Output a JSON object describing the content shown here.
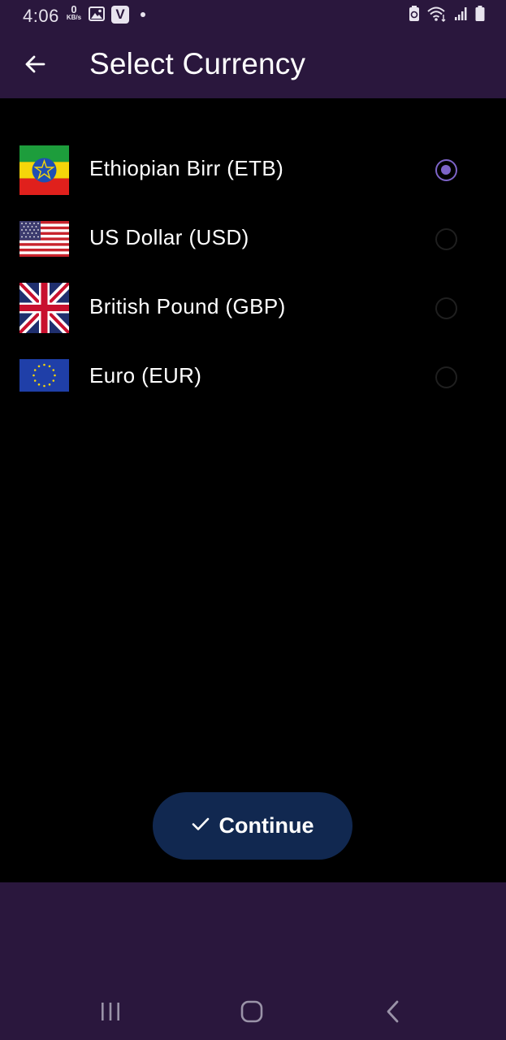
{
  "status_bar": {
    "time": "4:06",
    "net_speed_value": "0",
    "net_speed_unit": "KB/s",
    "app_icon_letter": "V"
  },
  "header": {
    "title": "Select Currency"
  },
  "currencies": [
    {
      "label": "Ethiopian Birr (ETB)",
      "flag_icon": "ethiopia-flag-icon",
      "selected": true
    },
    {
      "label": "US Dollar (USD)",
      "flag_icon": "usa-flag-icon",
      "selected": false
    },
    {
      "label": "British Pound (GBP)",
      "flag_icon": "uk-flag-icon",
      "selected": false
    },
    {
      "label": "Euro (EUR)",
      "flag_icon": "eu-flag-icon",
      "selected": false
    }
  ],
  "continue_button": {
    "label": "Continue",
    "icon": "check-icon"
  },
  "nav_bar": {
    "recents_icon": "recents-icon",
    "home_icon": "home-icon",
    "back_icon": "back-icon"
  },
  "colors": {
    "bar_background": "#2a173d",
    "accent": "#7d64c8",
    "button_background": "#112850"
  }
}
